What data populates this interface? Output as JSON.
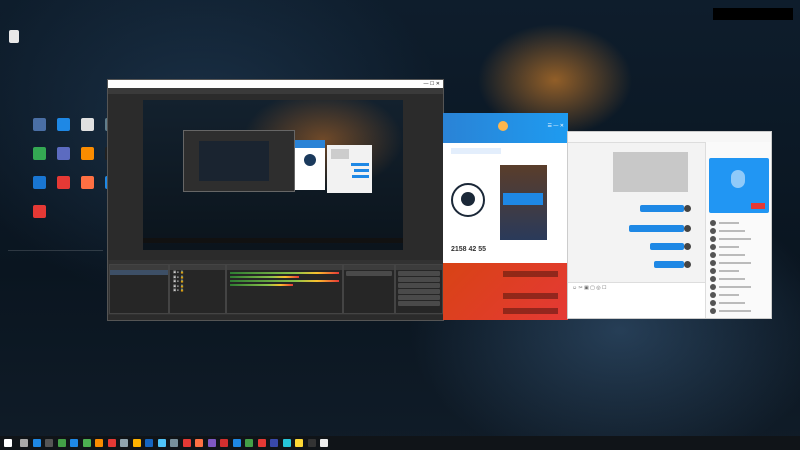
{
  "desktop": {
    "icons": [
      {
        "label": "",
        "color": "#cfd8dc"
      },
      {
        "label": "",
        "color": "#4a6fa5"
      },
      {
        "label": "",
        "color": "#1e88e5"
      },
      {
        "label": "",
        "color": "#e0e0e0"
      },
      {
        "label": "",
        "color": "#607d8b"
      },
      {
        "label": "",
        "color": "#34a853"
      },
      {
        "label": "",
        "color": "#5c6bc0"
      },
      {
        "label": "",
        "color": "#fb8c00"
      },
      {
        "label": "",
        "color": "#212121"
      },
      {
        "label": "",
        "color": "#1976d2"
      },
      {
        "label": "",
        "color": "#e53935"
      },
      {
        "label": "",
        "color": "#ff7043"
      },
      {
        "label": "",
        "color": "#1e88e5"
      },
      {
        "label": "",
        "color": "#e53935"
      }
    ],
    "side_text": [
      "",
      "",
      "",
      "",
      "",
      ""
    ]
  },
  "notification": {
    "text": ""
  },
  "obs": {
    "title": "",
    "menu": [
      "",
      "",
      "",
      "",
      "",
      "",
      ""
    ],
    "docks": {
      "scenes_title": "",
      "sources_title": "",
      "mixer_title": "",
      "transitions_title": "",
      "controls_title": "",
      "controls": [
        "",
        "",
        "",
        "",
        "",
        "",
        ""
      ]
    },
    "status": ""
  },
  "steam": {
    "tile_label": "",
    "stats": "2158 42 55"
  },
  "qq": {
    "title": "",
    "video_text": "",
    "messages": [
      "",
      "",
      "",
      "",
      ""
    ]
  },
  "taskbar": {
    "time": "",
    "date": ""
  },
  "watermark": {
    "line1": "",
    "line2": ""
  },
  "brand": {
    "obs_bg": "#2b2b2b",
    "qq_blue": "#1e88e5",
    "taskbar": "#101418"
  }
}
